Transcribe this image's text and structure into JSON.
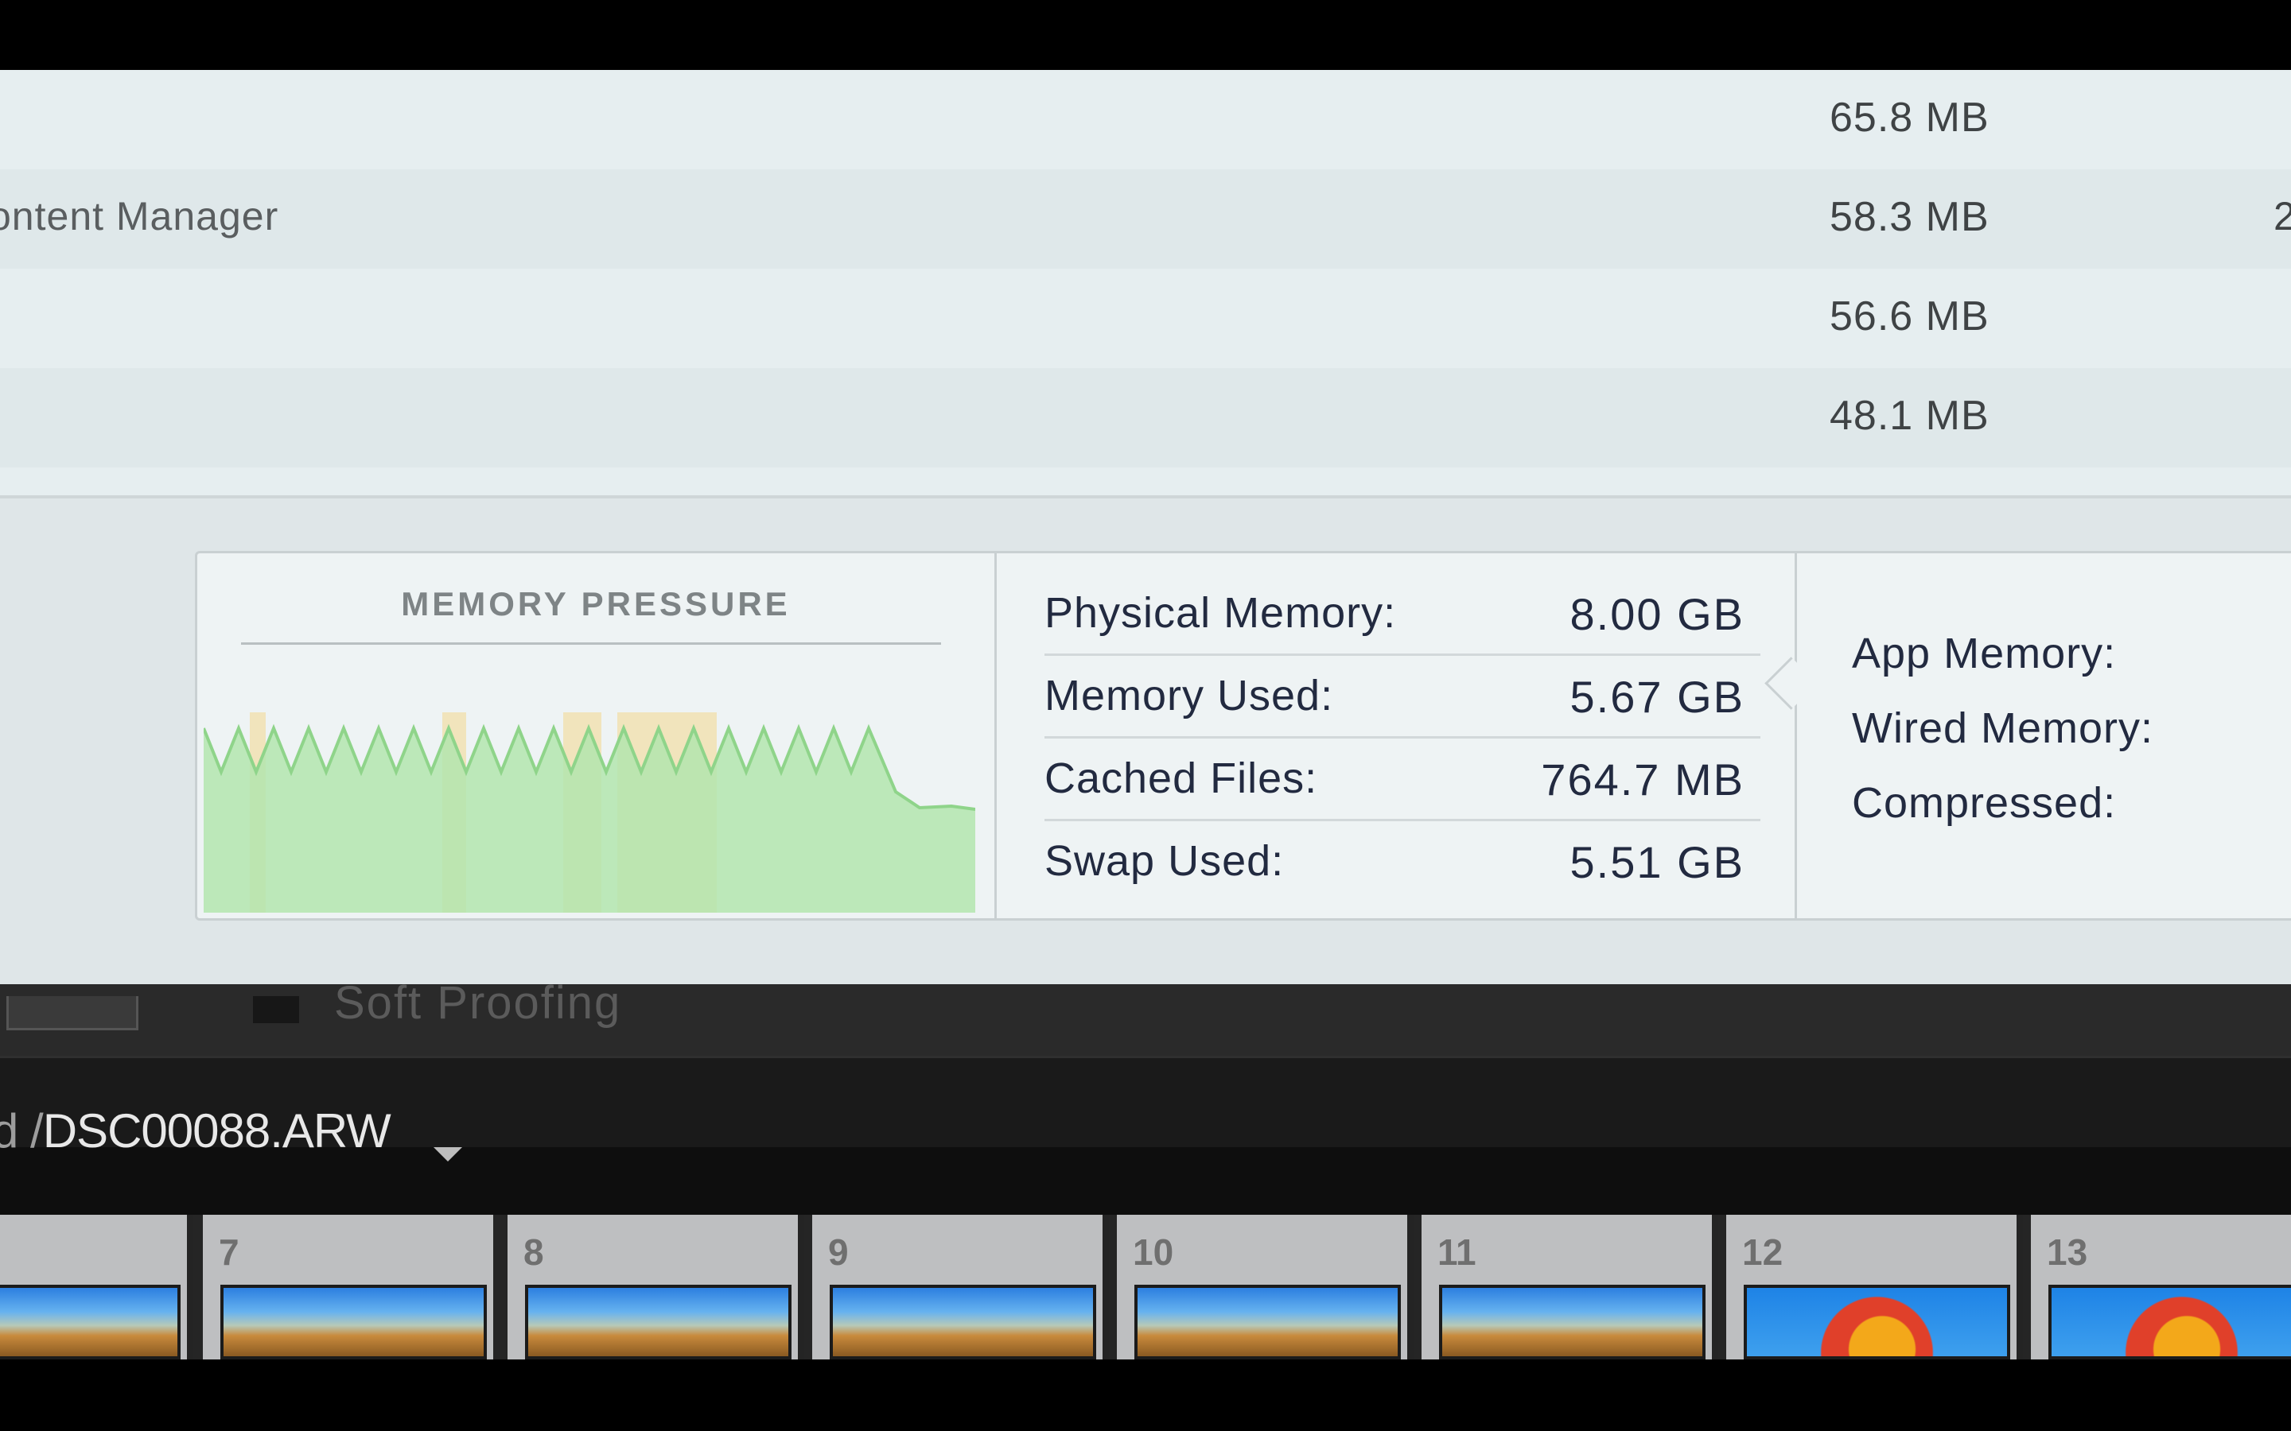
{
  "process_list": {
    "rows": [
      {
        "name": "",
        "memory": "65.8 MB",
        "extra": ""
      },
      {
        "name": "ontent Manager",
        "memory": "58.3 MB",
        "extra": "2"
      },
      {
        "name": "",
        "memory": "56.6 MB",
        "extra": ""
      },
      {
        "name": "",
        "memory": "48.1 MB",
        "extra": ""
      }
    ]
  },
  "memory_pressure": {
    "title": "MEMORY PRESSURE",
    "colors": {
      "green": "#b3e5ae",
      "green_line": "#8fd48a",
      "yellow": "#f1e4bc",
      "yellow_line": "#e0c98a"
    }
  },
  "memory_stats": {
    "physical_memory_label": "Physical Memory:",
    "physical_memory_value": "8.00 GB",
    "memory_used_label": "Memory Used:",
    "memory_used_value": "5.67 GB",
    "cached_files_label": "Cached Files:",
    "cached_files_value": "764.7 MB",
    "swap_used_label": "Swap Used:",
    "swap_used_value": "5.51 GB"
  },
  "memory_detail": {
    "app_memory_label": "App Memory:",
    "wired_memory_label": "Wired Memory:",
    "compressed_label": "Compressed:"
  },
  "background_app": {
    "toolbar_text": "Soft Proofing",
    "path_prefix": "d /",
    "file_name": "DSC00088.ARW",
    "filmstrip": [
      {
        "num": "",
        "type": "landscape"
      },
      {
        "num": "7",
        "type": "landscape"
      },
      {
        "num": "8",
        "type": "landscape"
      },
      {
        "num": "9",
        "type": "landscape"
      },
      {
        "num": "10",
        "type": "landscape"
      },
      {
        "num": "11",
        "type": "landscape"
      },
      {
        "num": "12",
        "type": "balloon"
      },
      {
        "num": "13",
        "type": "balloon"
      }
    ]
  }
}
